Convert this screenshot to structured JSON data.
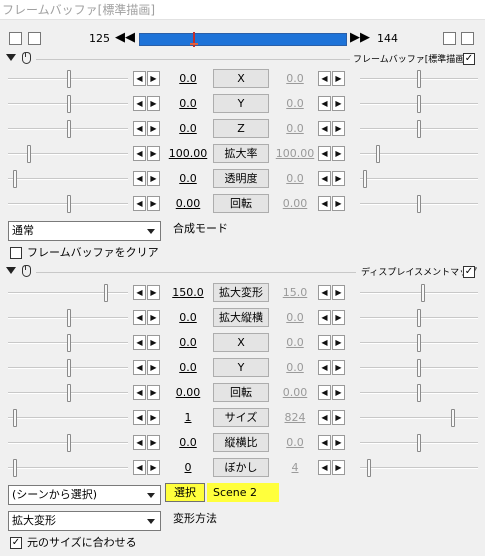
{
  "window": {
    "title": "フレームバッファ[標準描画]"
  },
  "timeline": {
    "start": "125",
    "end": "144",
    "prev_icon": "skip-back-icon",
    "next_icon": "skip-forward-icon"
  },
  "section1": {
    "title": "フレームバッファ[標準描画]",
    "checked": true,
    "rows": [
      {
        "left": "0.0",
        "label": "X",
        "right": "0.0"
      },
      {
        "left": "0.0",
        "label": "Y",
        "right": "0.0"
      },
      {
        "left": "0.0",
        "label": "Z",
        "right": "0.0"
      },
      {
        "left": "100.00",
        "label": "拡大率",
        "right": "100.00"
      },
      {
        "left": "0.0",
        "label": "透明度",
        "right": "0.0"
      },
      {
        "left": "0.00",
        "label": "回転",
        "right": "0.00"
      }
    ],
    "blend_mode": {
      "value": "通常",
      "label": "合成モード"
    },
    "clear_checkbox": {
      "label": "フレームバッファをクリア",
      "checked": false
    }
  },
  "section2": {
    "title": "ディスプレイスメントマップ",
    "checked": true,
    "rows": [
      {
        "left": "150.0",
        "label": "拡大変形",
        "right": "15.0"
      },
      {
        "left": "0.0",
        "label": "拡大縦横",
        "right": "0.0"
      },
      {
        "left": "0.0",
        "label": "X",
        "right": "0.0"
      },
      {
        "left": "0.0",
        "label": "Y",
        "right": "0.0"
      },
      {
        "left": "0.00",
        "label": "回転",
        "right": "0.00"
      },
      {
        "left": "1",
        "label": "サイズ",
        "right": "824"
      },
      {
        "left": "0.0",
        "label": "縦横比",
        "right": "0.0"
      },
      {
        "left": "0",
        "label": "ぼかし",
        "right": "4"
      }
    ],
    "source": {
      "value": "(シーンから選択)",
      "button": "選択",
      "scene": "Scene 2"
    },
    "transform": {
      "value": "拡大変形",
      "label": "変形方法"
    },
    "keep_size_checkbox": {
      "label": "元のサイズに合わせる",
      "checked": true
    }
  },
  "colors": {
    "highlight": "#ffff3c",
    "seek": "#1e73d8"
  }
}
